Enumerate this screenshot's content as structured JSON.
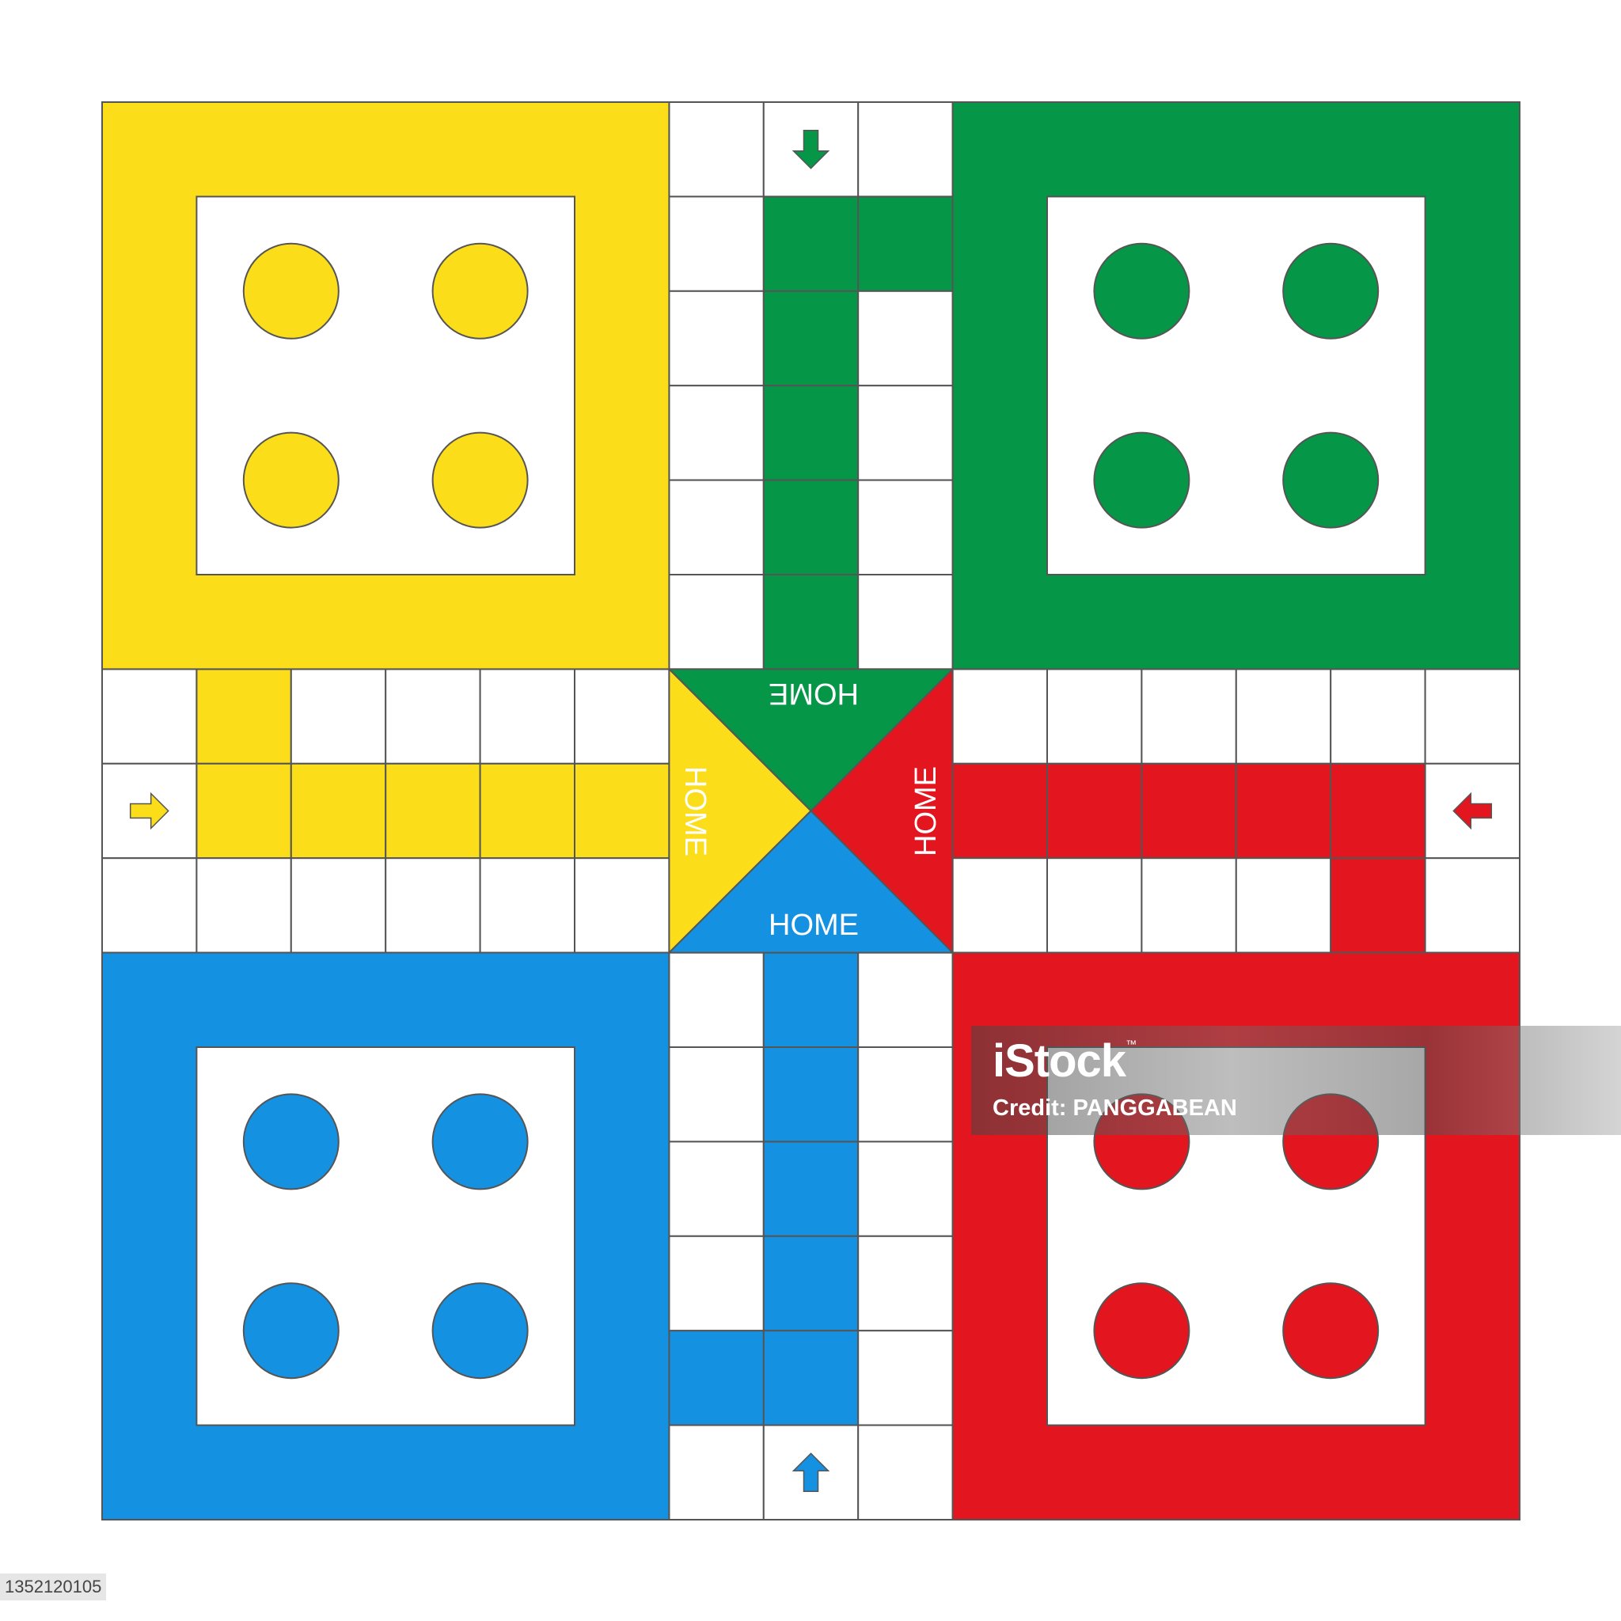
{
  "board": {
    "colors": {
      "yellow": "#fbdd1a",
      "green": "#069647",
      "red": "#e3161f",
      "blue": "#1591e1",
      "grid_line": "#555555",
      "cell": "#ffffff"
    },
    "bases": [
      {
        "color": "yellow",
        "corner": "top-left",
        "tokens": 4
      },
      {
        "color": "green",
        "corner": "top-right",
        "tokens": 4
      },
      {
        "color": "blue",
        "corner": "bottom-left",
        "tokens": 4
      },
      {
        "color": "red",
        "corner": "bottom-right",
        "tokens": 4
      }
    ],
    "home": {
      "green_label": "HOME",
      "yellow_label": "HOME",
      "red_label": "HOME",
      "blue_label": "HOME"
    },
    "start_arrows": [
      {
        "color": "green",
        "direction": "down",
        "icon": "arrow-down-icon"
      },
      {
        "color": "yellow",
        "direction": "right",
        "icon": "arrow-right-icon"
      },
      {
        "color": "red",
        "direction": "left",
        "icon": "arrow-left-icon"
      },
      {
        "color": "blue",
        "direction": "up",
        "icon": "arrow-up-icon"
      }
    ]
  },
  "watermark": {
    "brand": "iStock",
    "tm": "™",
    "credit": "Credit: PANGGABEAN"
  },
  "image_id": "1352120105"
}
